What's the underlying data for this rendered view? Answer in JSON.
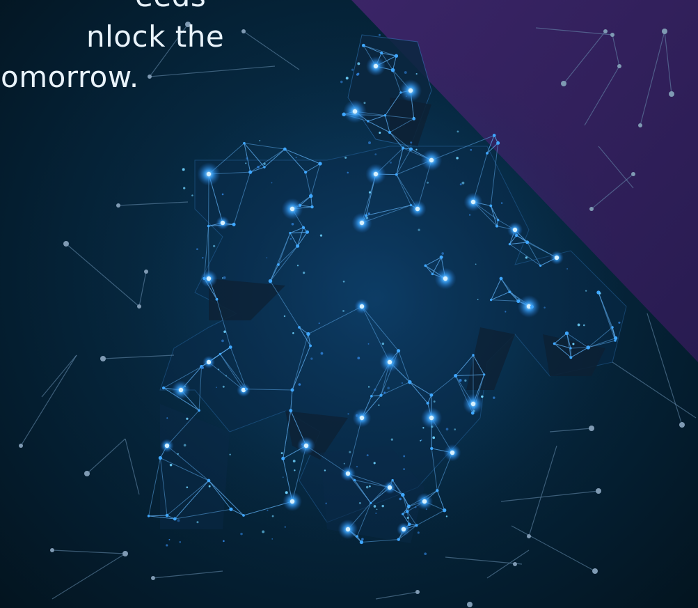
{
  "slide": {
    "headline_lines": [
      "eeds",
      "nlock the",
      "omorrow."
    ]
  },
  "colors": {
    "background_teal": "#062a40",
    "background_deep": "#03141f",
    "diagonal_purple": "#3b2466",
    "node_blue": "#2f9bff",
    "glow_cyan": "#6fd3ff",
    "line_blue": "#5aa6e6",
    "text": "#e9f3fb"
  },
  "graphic": {
    "subject": "glowing low-poly network puzzle piece",
    "icon": "puzzle-piece-icon"
  }
}
